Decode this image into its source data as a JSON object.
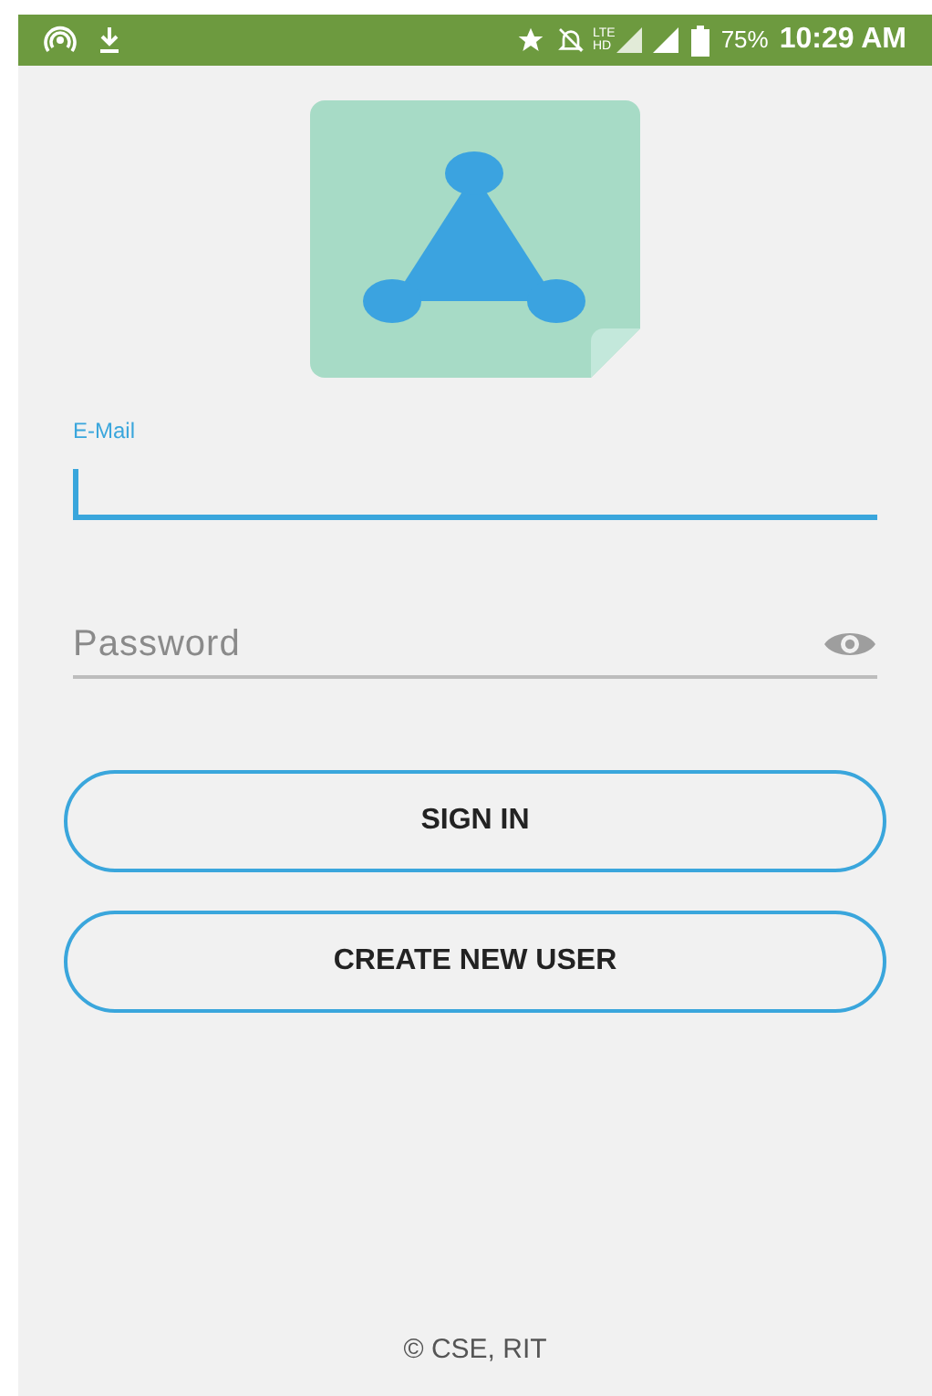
{
  "status_bar": {
    "network": [
      "LTE",
      "HD"
    ],
    "battery": "75%",
    "time": "10:29 AM"
  },
  "email": {
    "label": "E-Mail",
    "focused": true
  },
  "password": {
    "placeholder": "Password",
    "focused": false
  },
  "buttons": [
    {
      "label": "SIGN IN"
    },
    {
      "label": "CREATE NEW USER"
    }
  ],
  "footer": "© CSE, RIT"
}
